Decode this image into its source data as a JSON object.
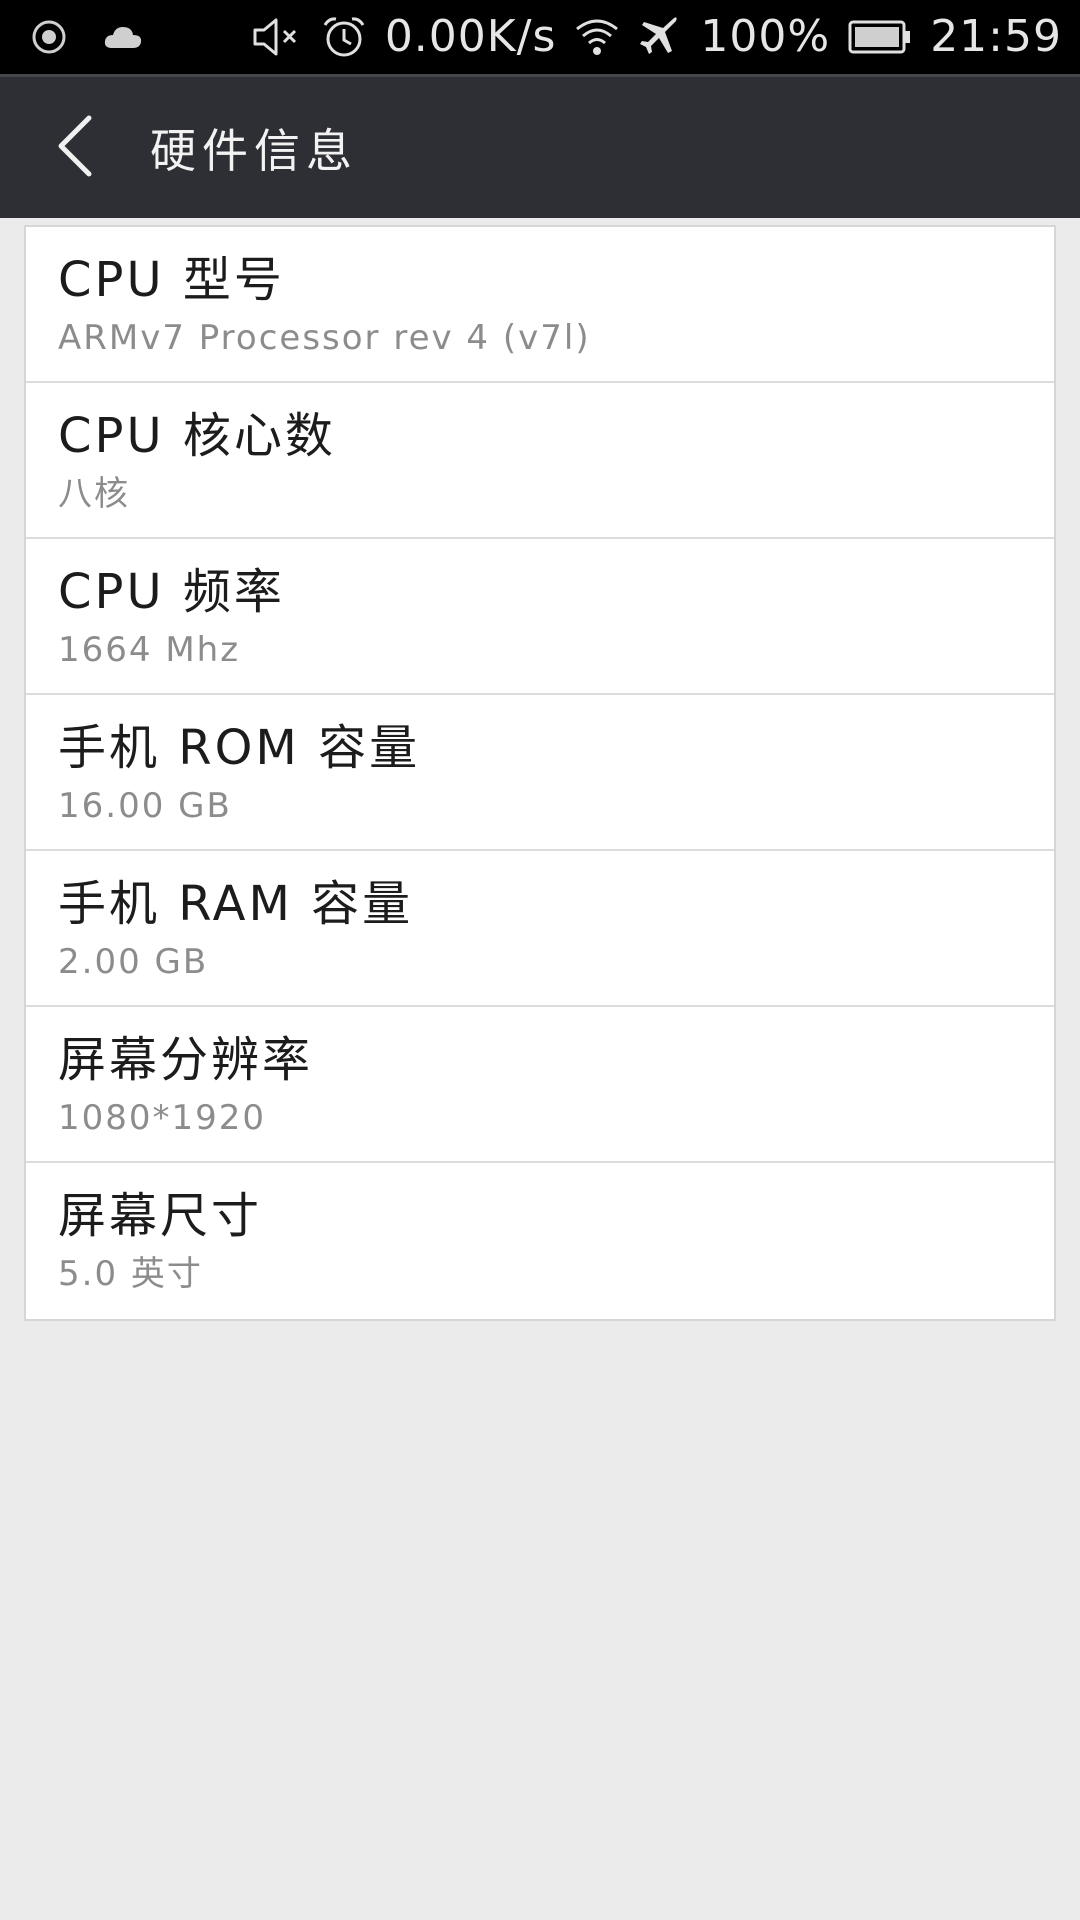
{
  "status_bar": {
    "network_speed": "0.00K/s",
    "battery": "100%",
    "time": "21:59",
    "icons": [
      "record-icon",
      "cloud-icon",
      "mute-icon",
      "alarm-icon",
      "wifi-icon",
      "airplane-icon",
      "battery-icon"
    ]
  },
  "header": {
    "title": "硬件信息",
    "back_icon": "chevron-left-icon"
  },
  "items": [
    {
      "label": "CPU 型号",
      "value": "ARMv7 Processor rev 4 (v7l)"
    },
    {
      "label": "CPU 核心数",
      "value": "八核"
    },
    {
      "label": "CPU 频率",
      "value": "1664 Mhz"
    },
    {
      "label": "手机 ROM 容量",
      "value": "16.00 GB"
    },
    {
      "label": "手机 RAM 容量",
      "value": "2.00 GB"
    },
    {
      "label": "屏幕分辨率",
      "value": "1080*1920"
    },
    {
      "label": "屏幕尺寸",
      "value": "5.0 英寸"
    }
  ],
  "colors": {
    "status_bar_bg": "#000000",
    "action_bar_bg": "#2d2f34",
    "page_bg": "#ebebeb",
    "card_bg": "#ffffff",
    "title_text": "#1c1c1c",
    "value_text": "#8c8c8c"
  }
}
